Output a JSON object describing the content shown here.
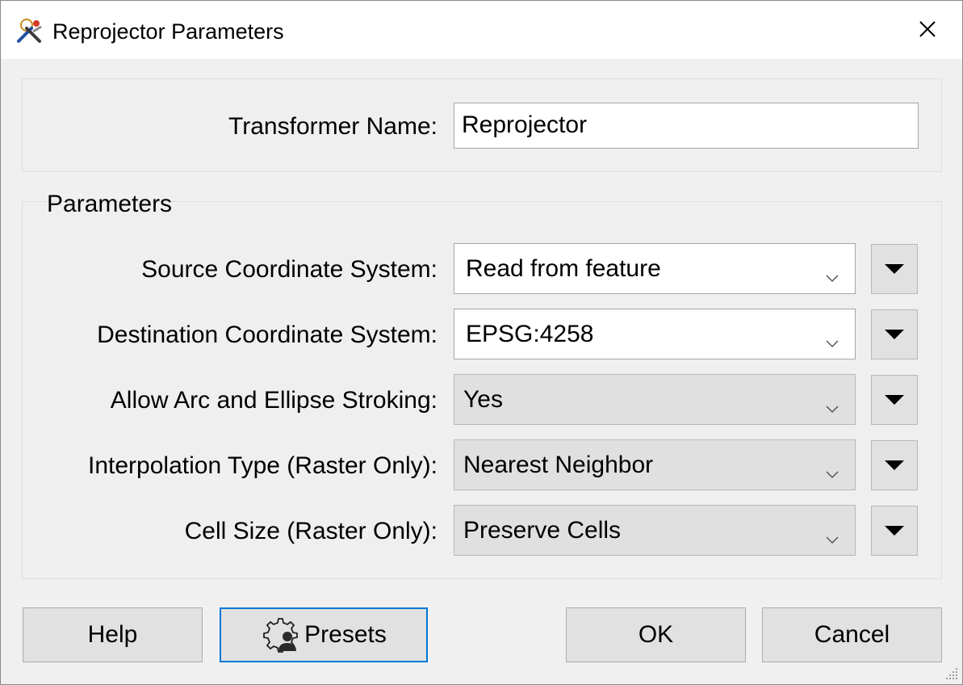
{
  "window": {
    "title": "Reprojector Parameters",
    "app_icon": "fme-transformer-icon",
    "close_icon": "close-icon"
  },
  "transformer": {
    "name_label": "Transformer Name:",
    "name_value": "Reprojector"
  },
  "parameters": {
    "section_title": "Parameters",
    "rows": [
      {
        "label": "Source Coordinate System:",
        "value": "Read from feature",
        "editable": true
      },
      {
        "label": "Destination Coordinate System:",
        "value": "EPSG:4258",
        "editable": true
      },
      {
        "label": "Allow Arc and Ellipse Stroking:",
        "value": "Yes",
        "editable": false
      },
      {
        "label": "Interpolation Type (Raster Only):",
        "value": "Nearest Neighbor",
        "editable": false
      },
      {
        "label": "Cell Size (Raster Only):",
        "value": "Preserve Cells",
        "editable": false
      }
    ]
  },
  "buttons": {
    "help": "Help",
    "presets": "Presets",
    "ok": "OK",
    "cancel": "Cancel"
  },
  "colors": {
    "focus_border": "#0078d7",
    "dialog_bg": "#f0f0f0",
    "button_bg": "#e1e1e1"
  }
}
